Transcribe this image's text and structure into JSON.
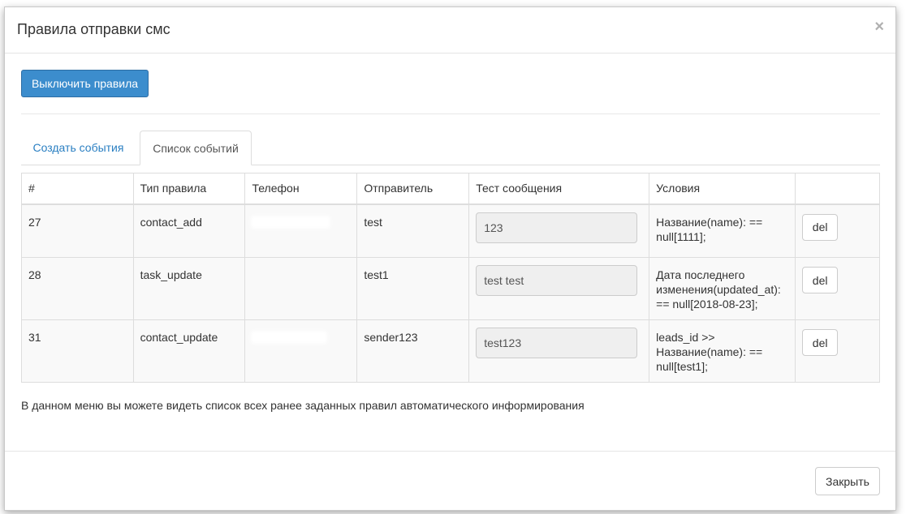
{
  "modal": {
    "title": "Правила отправки смс",
    "close_glyph": "×",
    "close_icon": "close-icon"
  },
  "actions": {
    "disable_rules_label": "Выключить правила"
  },
  "tabs": [
    {
      "label": "Создать события",
      "active": false
    },
    {
      "label": "Список событий",
      "active": true
    }
  ],
  "table": {
    "headers": [
      "#",
      "Тип правила",
      "Телефон",
      "Отправитель",
      "Тест сообщения",
      "Условия",
      ""
    ],
    "rows": [
      {
        "id": "27",
        "type": "contact_add",
        "phone": "",
        "phone_redacted": true,
        "sender": "test",
        "message": "123",
        "conditions": [
          "Название(name): ==",
          "null[1111];"
        ],
        "del_label": "del"
      },
      {
        "id": "28",
        "type": "task_update",
        "phone": "",
        "phone_redacted": false,
        "sender": "test1",
        "message": "test test",
        "conditions": [
          "Дата последнего",
          "изменения(updated_at):",
          "== null[2018-08-23];"
        ],
        "del_label": "del"
      },
      {
        "id": "31",
        "type": "contact_update",
        "phone": "",
        "phone_redacted": true,
        "sender": "sender123",
        "message": "test123",
        "conditions": [
          "leads_id >>",
          "Название(name): ==",
          "null[test1];"
        ],
        "del_label": "del"
      }
    ]
  },
  "info_text": "В данном меню вы можете видеть список всех ранее заданных правил автоматического информирования",
  "footer": {
    "close_label": "Закрыть"
  },
  "colors": {
    "primary": "#3c8dcd",
    "link": "#2a7fc2",
    "row_bg": "#f9f9f9"
  }
}
